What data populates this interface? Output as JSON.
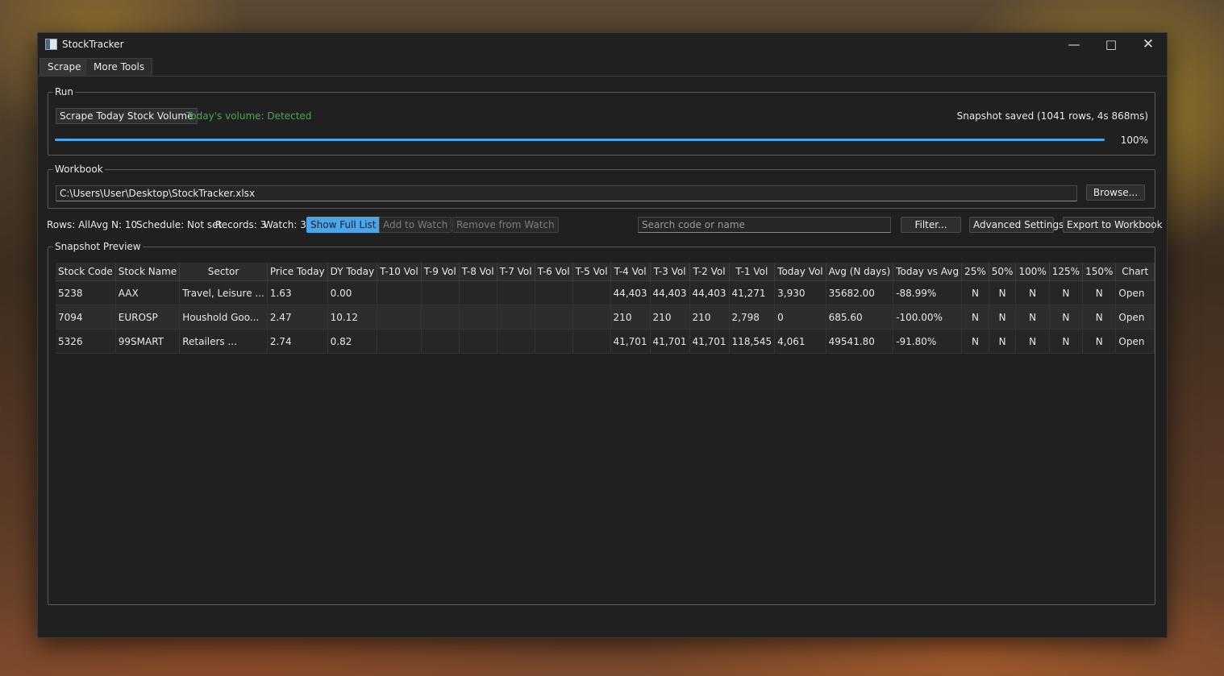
{
  "window": {
    "title": "StockTracker"
  },
  "tabs": [
    "Scrape",
    "More Tools"
  ],
  "run": {
    "legend": "Run",
    "scrape_button": "Scrape Today Stock Volume",
    "volume_status": "Today's volume: Detected",
    "snapshot_status": "Snapshot saved (1041 rows, 4s 868ms)",
    "progress_percent": 100,
    "progress_label": "100%"
  },
  "workbook": {
    "legend": "Workbook",
    "path": "C:\\Users\\User\\Desktop\\StockTracker.xlsx",
    "browse_button": "Browse..."
  },
  "toolbar": {
    "rows": "Rows: All",
    "avg_n": "Avg N: 10",
    "schedule": "Schedule: Not set",
    "records": "Records: 3",
    "watch": "Watch: 3",
    "show_full_list": "Show Full List",
    "add_to_watch": "Add to Watch",
    "remove_from_watch": "Remove from Watch",
    "search_placeholder": "Search code or name",
    "filter": "Filter...",
    "advanced_settings": "Advanced Settings",
    "export": "Export to Workbook"
  },
  "preview": {
    "legend": "Snapshot Preview",
    "columns": [
      "Stock Code",
      "Stock Name",
      "Sector",
      "Price Today",
      "DY Today",
      "T-10 Vol",
      "T-9 Vol",
      "T-8 Vol",
      "T-7 Vol",
      "T-6 Vol",
      "T-5 Vol",
      "T-4 Vol",
      "T-3 Vol",
      "T-2 Vol",
      "T-1 Vol",
      "Today Vol",
      "Avg (N days)",
      "Today vs Avg",
      "25%",
      "50%",
      "100%",
      "125%",
      "150%",
      "Chart"
    ],
    "rows": [
      [
        "5238",
        "AAX",
        "Travel, Leisure ...",
        "1.63",
        "0.00",
        "",
        "",
        "",
        "",
        "",
        "",
        "44,403",
        "44,403",
        "44,403",
        "41,271",
        "3,930",
        "35682.00",
        "-88.99%",
        "N",
        "N",
        "N",
        "N",
        "N",
        "Open"
      ],
      [
        "7094",
        "EUROSP",
        "Houshold Goo...",
        "2.47",
        "10.12",
        "",
        "",
        "",
        "",
        "",
        "",
        "210",
        "210",
        "210",
        "2,798",
        "0",
        "685.60",
        "-100.00%",
        "N",
        "N",
        "N",
        "N",
        "N",
        "Open"
      ],
      [
        "5326",
        "99SMART",
        "Retailers ...",
        "2.74",
        "0.82",
        "",
        "",
        "",
        "",
        "",
        "",
        "41,701",
        "41,701",
        "41,701",
        "118,545",
        "4,061",
        "49541.80",
        "-91.80%",
        "N",
        "N",
        "N",
        "N",
        "N",
        "Open"
      ]
    ]
  },
  "colors": {
    "accent": "#4aa6e8",
    "success": "#3fae4a",
    "link": "#4fa8f0"
  }
}
